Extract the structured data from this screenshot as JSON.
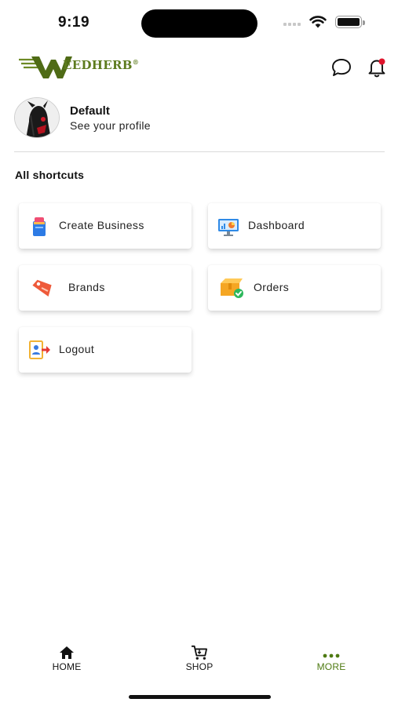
{
  "status_bar": {
    "time": "9:19"
  },
  "header": {
    "logo_text": "EEDHERB",
    "logo_reg": "®",
    "logo_color": "#5d7b1e",
    "chat_icon": "chat-bubble-icon",
    "bell_icon": "bell-icon",
    "notification_dot_color": "#e0142c"
  },
  "profile": {
    "name": "Default",
    "subtitle": "See your profile"
  },
  "shortcuts": {
    "title": "All shortcuts",
    "items": [
      {
        "label": "Create Business",
        "icon": "create-business-icon"
      },
      {
        "label": "Dashboard",
        "icon": "dashboard-icon"
      },
      {
        "label": "Brands",
        "icon": "brands-tag-icon"
      },
      {
        "label": "Orders",
        "icon": "orders-box-icon"
      },
      {
        "label": "Logout",
        "icon": "logout-icon"
      }
    ]
  },
  "bottom_nav": {
    "items": [
      {
        "label": "HOME",
        "icon": "home-icon",
        "active": false
      },
      {
        "label": "SHOP",
        "icon": "cart-icon",
        "active": false
      },
      {
        "label": "MORE",
        "icon": "more-dots-icon",
        "active": true
      }
    ],
    "active_color": "#4e7a12"
  }
}
